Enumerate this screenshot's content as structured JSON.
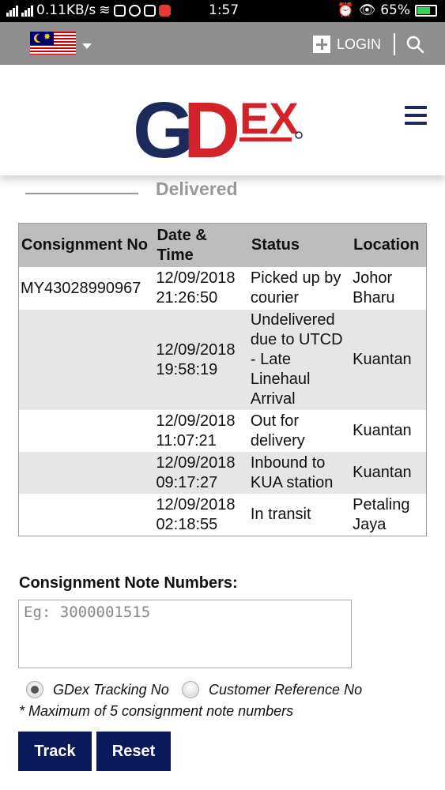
{
  "status_bar": {
    "net_speed": "0.11KB/s",
    "time": "1:57",
    "battery": "65%"
  },
  "topbar": {
    "flag": "malaysia-flag",
    "login_label": "LOGIN",
    "search_icon": "search-icon"
  },
  "header": {
    "logo_text": "GDEX",
    "menu_icon": "hamburger-menu-icon",
    "brand_colors": {
      "navy": "#1b2a5a",
      "red": "#d2232a"
    }
  },
  "tabs": {
    "delivered_label": "Delivered"
  },
  "tracking_table": {
    "headers": [
      "Consignment No",
      "Date & Time",
      "Status",
      "Location"
    ],
    "rows": [
      {
        "consignment": "MY43028990967",
        "datetime": "12/09/2018 21:26:50",
        "status": "Picked up by courier",
        "location": "Johor Bharu"
      },
      {
        "consignment": "",
        "datetime": "12/09/2018 19:58:19",
        "status": "Undelivered due to UTCD - Late Linehaul Arrival",
        "location": "Kuantan"
      },
      {
        "consignment": "",
        "datetime": "12/09/2018 11:07:21",
        "status": "Out for delivery",
        "location": "Kuantan"
      },
      {
        "consignment": "",
        "datetime": "12/09/2018 09:17:27",
        "status": "Inbound to KUA station",
        "location": "Kuantan"
      },
      {
        "consignment": "",
        "datetime": "12/09/2018 02:18:55",
        "status": "In transit",
        "location": "Petaling Jaya"
      }
    ]
  },
  "form": {
    "label": "Consignment Note Numbers:",
    "value": "",
    "placeholder": "Eg: 3000001515",
    "radio_options": [
      {
        "label": "GDex Tracking No",
        "checked": true
      },
      {
        "label": "Customer Reference No",
        "checked": false
      }
    ],
    "note": "* Maximum of 5 consignment note numbers",
    "track_label": "Track",
    "reset_label": "Reset"
  }
}
